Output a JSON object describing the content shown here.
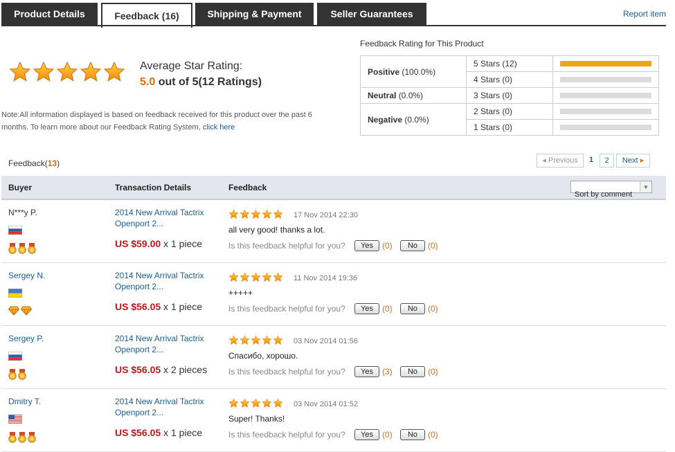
{
  "tabs": [
    "Product Details",
    "Feedback (16)",
    "Shipping & Payment",
    "Seller Guarantees"
  ],
  "report": "Report item",
  "summary": {
    "avg_title": "Average Star Rating:",
    "avg_value": "5.0",
    "avg_suffix": "out of 5(12 Ratings)",
    "note": "Note:All information displayed is based on feedback received for this product over the past 6 months. To learn more about our Feedback Rating System, ",
    "note_link": "click here"
  },
  "rating_table": {
    "title": "Feedback Rating for This Product",
    "positive_label": "Positive",
    "positive_pct": "(100.0%)",
    "neutral_label": "Neutral",
    "neutral_pct": "(0.0%)",
    "negative_label": "Negative",
    "negative_pct": "(0.0%)",
    "rows": [
      {
        "label": "5 Stars (12)",
        "fill": 1.0
      },
      {
        "label": "4 Stars (0)",
        "fill": 0
      },
      {
        "label": "3 Stars (0)",
        "fill": 0
      },
      {
        "label": "2 Stars (0)",
        "fill": 0
      },
      {
        "label": "1 Stars (0)",
        "fill": 0
      }
    ]
  },
  "feedback": {
    "label": "Feedback(",
    "count": "13",
    "close": ")",
    "pager": {
      "prev": "Previous",
      "p1": "1",
      "p2": "2",
      "next": "Next"
    },
    "cols": {
      "buyer": "Buyer",
      "tx": "Transaction Details",
      "fb": "Feedback"
    },
    "sort": "Sort by comment",
    "helpful_q": "Is this feedback helpful for you?",
    "yes": "Yes",
    "no": "No"
  },
  "entries": [
    {
      "buyer": "N***y P.",
      "flag": "ru",
      "medals": 3,
      "medal_type": "medal",
      "product": "2014 New Arrival Tactrix Openport 2...",
      "price": "US $59.00",
      "qty": " x 1 piece",
      "date": "17 Nov 2014 22:30",
      "comment": "all very good! thanks a lot.",
      "yes": "(0)",
      "no": "(0)"
    },
    {
      "buyer": "Sergey N.",
      "flag": "ua",
      "medals": 2,
      "medal_type": "diamond",
      "product": "2014 New Arrival Tactrix Openport 2...",
      "price": "US $56.05",
      "qty": " x 1 piece",
      "date": "11 Nov 2014 19:36",
      "comment": "+++++",
      "yes": "(0)",
      "no": "(0)"
    },
    {
      "buyer": "Sergey P.",
      "flag": "ru",
      "medals": 2,
      "medal_type": "medal",
      "product": "2014 New Arrival Tactrix Openport 2...",
      "price": "US $56.05",
      "qty": " x 2 pieces",
      "date": "03 Nov 2014 01:56",
      "comment": "Спасибо, хорошо.",
      "yes": "(3)",
      "no": "(0)"
    },
    {
      "buyer": "Dmitry T.",
      "flag": "us",
      "medals": 3,
      "medal_type": "medal",
      "product": "2014 New Arrival Tactrix Openport 2...",
      "price": "US $56.05",
      "qty": " x 1 piece",
      "date": "03 Nov 2014 01:52",
      "comment": "Super! Thanks!",
      "yes": "(0)",
      "no": "(0)"
    }
  ]
}
